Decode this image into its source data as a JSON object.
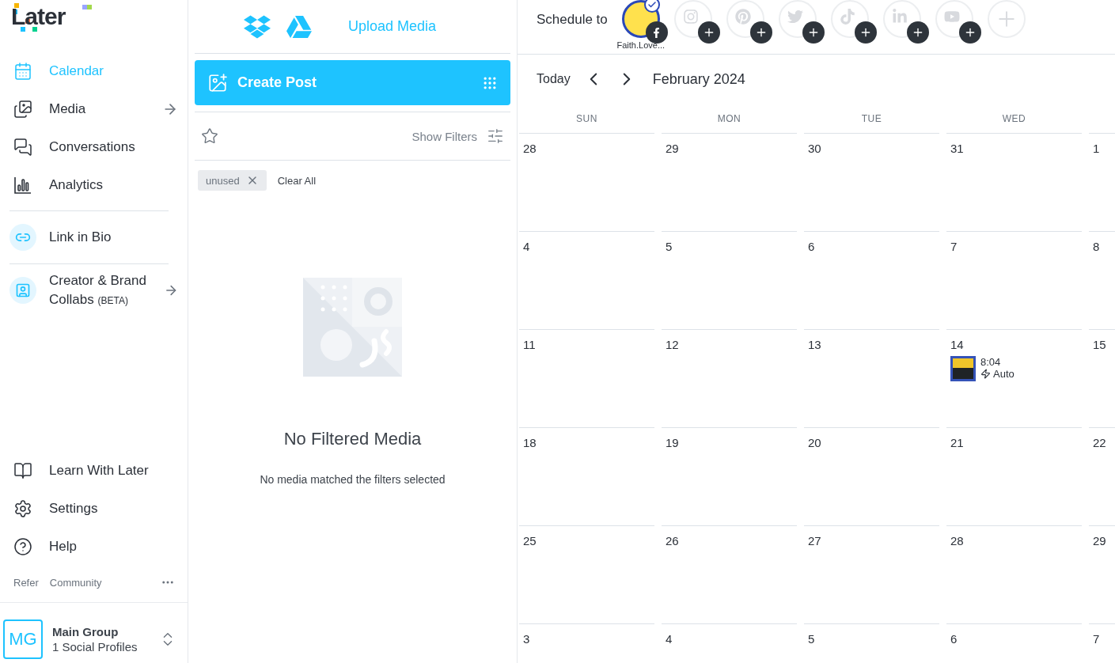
{
  "sidebar": {
    "logo": "Later",
    "nav": [
      {
        "label": "Calendar",
        "selected": true,
        "expandable": false
      },
      {
        "label": "Media",
        "selected": false,
        "expandable": true
      },
      {
        "label": "Conversations",
        "selected": false,
        "expandable": false
      },
      {
        "label": "Analytics",
        "selected": false,
        "expandable": false
      }
    ],
    "features": [
      {
        "label": "Link in Bio",
        "expandable": false
      },
      {
        "label": "Creator & Brand Collabs",
        "tag": "(BETA)",
        "expandable": true
      }
    ],
    "bottom_nav": [
      {
        "label": "Learn With Later"
      },
      {
        "label": "Settings"
      },
      {
        "label": "Help"
      }
    ],
    "footer_links": [
      "Refer",
      "Community"
    ],
    "account": {
      "initials": "MG",
      "name": "Main Group",
      "subtitle": "1 Social Profiles"
    }
  },
  "media_panel": {
    "upload_label": "Upload Media",
    "create_post": "Create Post",
    "show_filters": "Show Filters",
    "filters": [
      {
        "label": "unused"
      }
    ],
    "clear_all": "Clear All",
    "empty_title": "No Filtered Media",
    "empty_text": "No media matched the filters selected"
  },
  "schedule": {
    "label": "Schedule to",
    "profiles": [
      {
        "kind": "facebook",
        "name": "Faith.Love...",
        "selected": true
      },
      {
        "kind": "instagram",
        "selected": false
      },
      {
        "kind": "pinterest",
        "selected": false
      },
      {
        "kind": "twitter",
        "selected": false
      },
      {
        "kind": "tiktok",
        "selected": false
      },
      {
        "kind": "linkedin",
        "selected": false
      },
      {
        "kind": "youtube",
        "selected": false
      },
      {
        "kind": "add",
        "selected": false
      }
    ]
  },
  "calendar": {
    "today": "Today",
    "month": "February 2024",
    "weekdays": [
      "SUN",
      "MON",
      "TUE",
      "WED"
    ],
    "weeks": [
      [
        {
          "date": "28"
        },
        {
          "date": "29"
        },
        {
          "date": "30"
        },
        {
          "date": "31"
        },
        {
          "date": "1"
        }
      ],
      [
        {
          "date": "4"
        },
        {
          "date": "5"
        },
        {
          "date": "6"
        },
        {
          "date": "7"
        },
        {
          "date": "8"
        }
      ],
      [
        {
          "date": "11"
        },
        {
          "date": "12"
        },
        {
          "date": "13"
        },
        {
          "date": "14",
          "event": {
            "time": "8:04",
            "mode": "Auto"
          }
        },
        {
          "date": "15"
        }
      ],
      [
        {
          "date": "18"
        },
        {
          "date": "19"
        },
        {
          "date": "20"
        },
        {
          "date": "21"
        },
        {
          "date": "22"
        }
      ],
      [
        {
          "date": "25"
        },
        {
          "date": "26"
        },
        {
          "date": "27"
        },
        {
          "date": "28"
        },
        {
          "date": "29"
        }
      ],
      [
        {
          "date": "3"
        },
        {
          "date": "4"
        },
        {
          "date": "5"
        },
        {
          "date": "6"
        },
        {
          "date": "7"
        }
      ]
    ]
  }
}
